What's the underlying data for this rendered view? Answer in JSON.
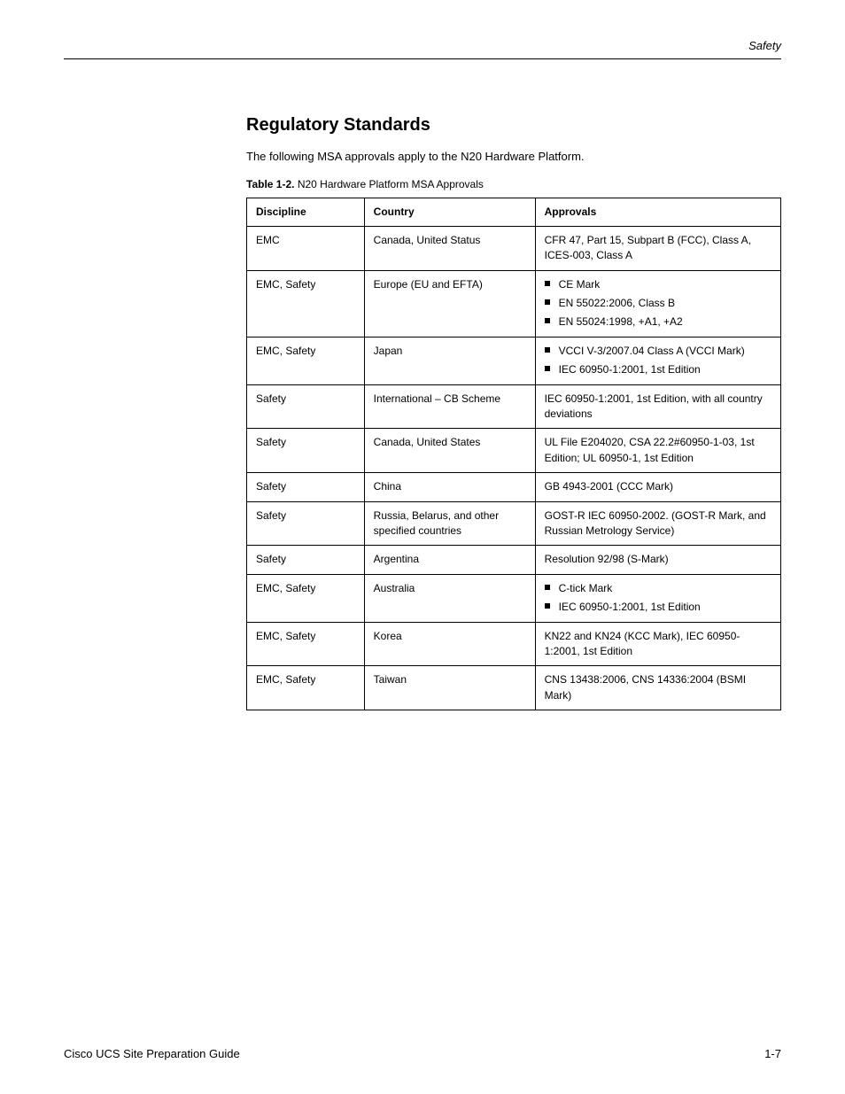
{
  "header": {
    "text": "Safety"
  },
  "section": {
    "title": "Regulatory Standards",
    "intro": "The following MSA approvals apply to the N20 Hardware Platform.",
    "captionLabel": "Table 1-2.",
    "captionText": "N20 Hardware Platform MSA Approvals"
  },
  "table": {
    "headers": {
      "c1": "Discipline",
      "c2": "Country",
      "c3": "Approvals"
    },
    "rows": [
      {
        "c1": "EMC",
        "c2": "Canada, United Status",
        "c3": {
          "type": "text",
          "value": "CFR 47, Part 15, Subpart B (FCC), Class A, ICES-003, Class A"
        }
      },
      {
        "c1": "EMC, Safety",
        "c2": "Europe (EU and EFTA)",
        "c3": {
          "type": "list",
          "items": [
            "CE Mark",
            "EN 55022:2006, Class B",
            "EN 55024:1998, +A1, +A2"
          ]
        }
      },
      {
        "c1": "EMC, Safety",
        "c2": "Japan",
        "c3": {
          "type": "list",
          "items": [
            "VCCI V-3/2007.04 Class A (VCCI Mark)",
            "IEC 60950-1:2001, 1st Edition"
          ]
        }
      },
      {
        "c1": "Safety",
        "c2": "International – CB Scheme",
        "c3": {
          "type": "text",
          "value": "IEC 60950-1:2001, 1st Edition, with all country deviations"
        }
      },
      {
        "c1": "Safety",
        "c2": "Canada, United States",
        "c3": {
          "type": "text",
          "value": "UL File E204020, CSA 22.2#60950-1-03, 1st Edition; UL 60950-1, 1st Edition"
        }
      },
      {
        "c1": "Safety",
        "c2": "China",
        "c3": {
          "type": "text",
          "value": "GB 4943-2001 (CCC Mark)"
        }
      },
      {
        "c1": "Safety",
        "c2": "Russia, Belarus, and other specified countries",
        "c3": {
          "type": "text",
          "value": "GOST-R IEC 60950-2002. (GOST-R Mark, and Russian Metrology Service)"
        }
      },
      {
        "c1": "Safety",
        "c2": "Argentina",
        "c3": {
          "type": "text",
          "value": "Resolution 92/98 (S-Mark)"
        }
      },
      {
        "c1": "EMC, Safety",
        "c2": "Australia",
        "c3": {
          "type": "list",
          "items": [
            "C-tick Mark",
            "IEC 60950-1:2001, 1st Edition"
          ]
        }
      },
      {
        "c1": "EMC, Safety",
        "c2": "Korea",
        "c3": {
          "type": "text",
          "value": "KN22 and KN24 (KCC Mark), IEC 60950-1:2001, 1st Edition"
        }
      },
      {
        "c1": "EMC, Safety",
        "c2": "Taiwan",
        "c3": {
          "type": "text",
          "value": "CNS 13438:2006, CNS 14336:2004 (BSMI Mark)"
        }
      }
    ]
  },
  "footer": {
    "left": "Cisco UCS Site Preparation Guide",
    "right": "1-7"
  }
}
